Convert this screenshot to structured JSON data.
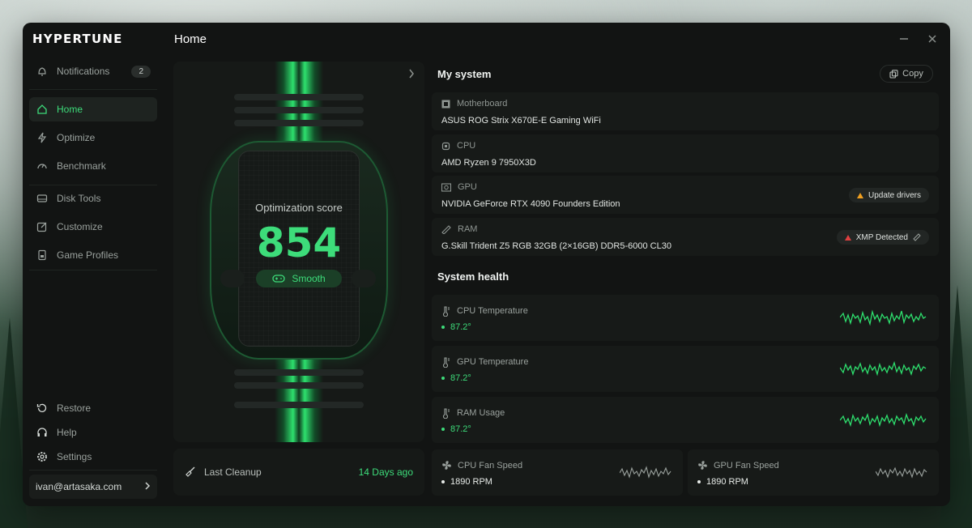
{
  "app": {
    "brand": "HYPERTUNE",
    "page_title": "Home"
  },
  "sidebar": {
    "notifications": {
      "label": "Notifications",
      "count": "2"
    },
    "items": [
      {
        "label": "Home",
        "icon": "home-icon",
        "active": true
      },
      {
        "label": "Optimize",
        "icon": "lightning-icon"
      },
      {
        "label": "Benchmark",
        "icon": "gauge-icon"
      },
      {
        "label": "Disk Tools",
        "icon": "disk-icon"
      },
      {
        "label": "Customize",
        "icon": "edit-icon"
      },
      {
        "label": "Game Profiles",
        "icon": "game-profile-icon"
      }
    ],
    "bottom": [
      {
        "label": "Restore",
        "icon": "restore-icon"
      },
      {
        "label": "Help",
        "icon": "headset-icon"
      },
      {
        "label": "Settings",
        "icon": "gear-icon"
      }
    ],
    "user_email": "ivan@artasaka.com"
  },
  "score": {
    "label": "Optimization score",
    "value": "854",
    "status": "Smooth",
    "accent": "#3ddc7a"
  },
  "cleanup": {
    "label": "Last Cleanup",
    "value": "14 Days ago"
  },
  "system": {
    "title": "My system",
    "copy_label": "Copy",
    "items": [
      {
        "label": "Motherboard",
        "value": "ASUS ROG Strix X670E-E Gaming WiFi",
        "icon": "motherboard-icon"
      },
      {
        "label": "CPU",
        "value": "AMD Ryzen 9 7950X3D",
        "icon": "cpu-icon"
      },
      {
        "label": "GPU",
        "value": "NVIDIA GeForce RTX 4090 Founders Edition",
        "icon": "gpu-icon",
        "badge": "Update drivers",
        "badge_color": "#f0a020"
      },
      {
        "label": "RAM",
        "value": "G.Skill Trident Z5 RGB 32GB (2×16GB) DDR5-6000 CL30",
        "icon": "ram-icon",
        "badge": "XMP Detected",
        "badge_color": "#e04040"
      }
    ]
  },
  "health": {
    "title": "System health",
    "items": [
      {
        "label": "CPU Temperature",
        "value": "87.2°",
        "icon": "thermometer-icon"
      },
      {
        "label": "GPU Temperature",
        "value": "87.2°",
        "icon": "thermometer-icon"
      },
      {
        "label": "RAM Usage",
        "value": "87.2°",
        "icon": "thermometer-icon"
      }
    ],
    "fans": [
      {
        "label": "CPU Fan Speed",
        "value": "1890 RPM",
        "icon": "fan-icon"
      },
      {
        "label": "GPU Fan Speed",
        "value": "1890 RPM",
        "icon": "fan-icon"
      }
    ]
  }
}
